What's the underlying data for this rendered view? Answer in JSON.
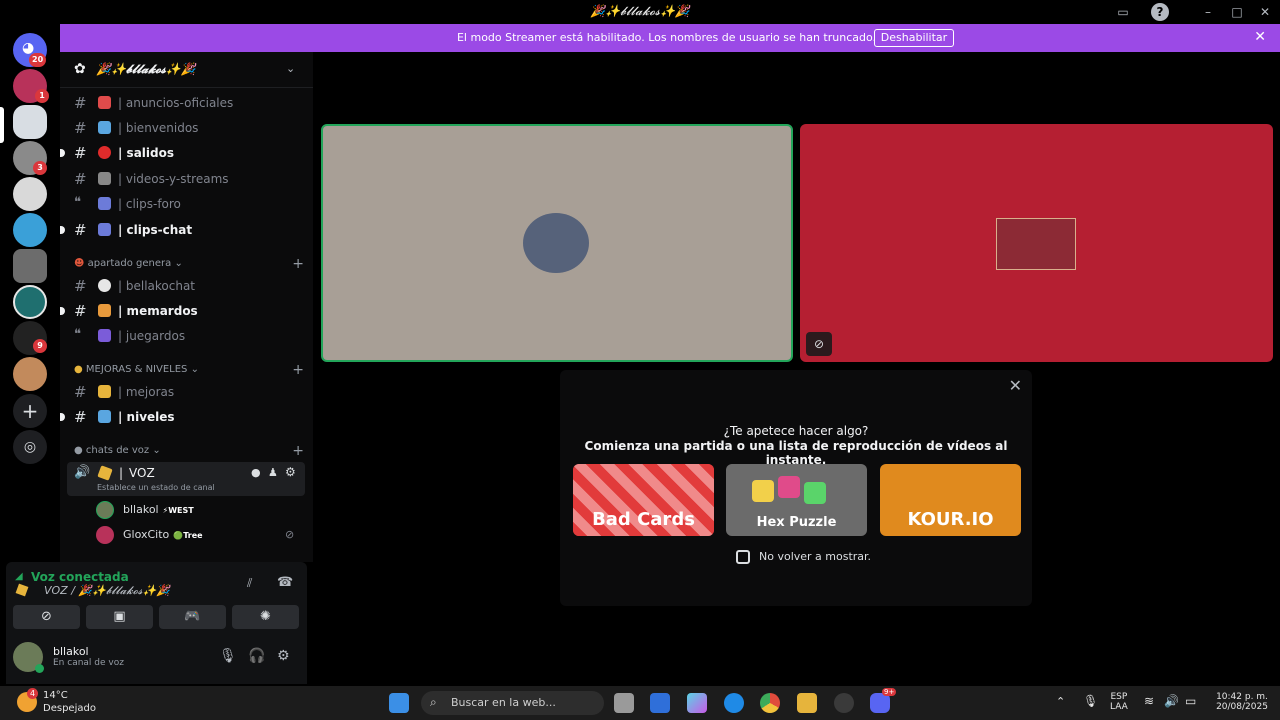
{
  "window": {
    "title": "🎉✨𝓫𝓵𝓵𝓪𝓴𝓸𝓼✨🎉"
  },
  "banner": {
    "message": "El modo Streamer está habilitado. Los nombres de usuario se han truncado.",
    "button": "Deshabilitar"
  },
  "servers": [
    {
      "name": "direct-messages",
      "badge": "20",
      "color": "#5865f2"
    },
    {
      "name": "server-1",
      "badge": "1",
      "color": "#b8325a"
    },
    {
      "name": "server-2",
      "badge": "",
      "color": "#d8dde3"
    },
    {
      "name": "server-3",
      "badge": "3",
      "color": "#8a8a8a"
    },
    {
      "name": "server-4",
      "badge": "",
      "color": "#d9d9d9"
    },
    {
      "name": "server-5",
      "badge": "",
      "color": "#3aa0d8"
    },
    {
      "name": "server-6",
      "badge": "",
      "color": "#6c6c6c"
    },
    {
      "name": "server-7",
      "badge": "",
      "color": "#1f6f6f"
    },
    {
      "name": "server-8",
      "badge": "9",
      "color": "#222"
    },
    {
      "name": "server-9",
      "badge": "",
      "color": "#c28a5c"
    }
  ],
  "server": {
    "name": "🎉✨𝓫𝓵𝓵𝓪𝓴𝓸𝓼✨🎉",
    "channels_top": [
      {
        "label": "| anuncios-oficiales",
        "unread": false,
        "type": "text",
        "emoji_color": "#e04b4b"
      },
      {
        "label": "| bienvenidos",
        "unread": false,
        "type": "text",
        "emoji_color": "#5aa6e0"
      },
      {
        "label": "| salidos",
        "unread": true,
        "type": "text",
        "emoji_color": "#e02b2b"
      },
      {
        "label": "| videos-y-streams",
        "unread": false,
        "type": "text",
        "emoji_color": "#888"
      },
      {
        "label": "| clips-foro",
        "unread": false,
        "type": "forum",
        "emoji_color": "#6c7bd9"
      },
      {
        "label": "| clips-chat",
        "unread": true,
        "type": "text",
        "emoji_color": "#6c7bd9"
      }
    ],
    "category_1": "apartado genera",
    "channels_mid": [
      {
        "label": "| bellakochat",
        "unread": false,
        "type": "text",
        "emoji_color": "#e6e6e6"
      },
      {
        "label": "| memardos",
        "unread": true,
        "type": "text",
        "emoji_color": "#e89a3c"
      },
      {
        "label": "| juegardos",
        "unread": false,
        "type": "forum",
        "emoji_color": "#7b5cd9"
      }
    ],
    "category_2": "MEJORAS & NIVELES",
    "channels_low": [
      {
        "label": "| mejoras",
        "unread": false,
        "type": "text",
        "emoji_color": "#e6b43c"
      },
      {
        "label": "| niveles",
        "unread": true,
        "type": "text",
        "emoji_color": "#5aa6e0"
      }
    ],
    "category_3": "chats de voz",
    "voice_channel": {
      "label": "VOZ",
      "status": "Establece un estado de canal"
    },
    "voice_users": [
      {
        "name": "bllakol",
        "tag": "⚡WEST",
        "tag_color": "#f2f3f5",
        "avatar": "#6b7b58"
      },
      {
        "name": "GloxCito",
        "tag": "🟢Tree",
        "tag_color": "#f2f3f5",
        "avatar": "#b8325a"
      }
    ]
  },
  "voice_panel": {
    "status": "Voz conectada",
    "location": "VOZ / 🎉✨𝓫𝓵𝓵𝓪𝓴𝓸𝓼✨🎉"
  },
  "user": {
    "name": "bllakol",
    "status": "En canal de voz"
  },
  "popup": {
    "title": "¿Te apetece hacer algo?",
    "subtitle": "Comienza una partida o una lista de reproducción de vídeos al instante.",
    "games": [
      {
        "name": "Bad Cards",
        "color": "#e23b3b"
      },
      {
        "name": "Hex Puzzle",
        "color": "#6b6b6b"
      },
      {
        "name": "KOUR.IO",
        "color": "#e08a1e"
      }
    ],
    "checkbox_label": "No volver a mostrar."
  },
  "taskbar": {
    "weather_temp": "14°C",
    "weather_text": "Despejado",
    "weather_badge": "4",
    "search_placeholder": "Buscar en la web...",
    "lang_1": "ESP",
    "lang_2": "LAA",
    "time": "10:42 p. m.",
    "date": "20/08/2025",
    "discord_badge": "9+"
  }
}
